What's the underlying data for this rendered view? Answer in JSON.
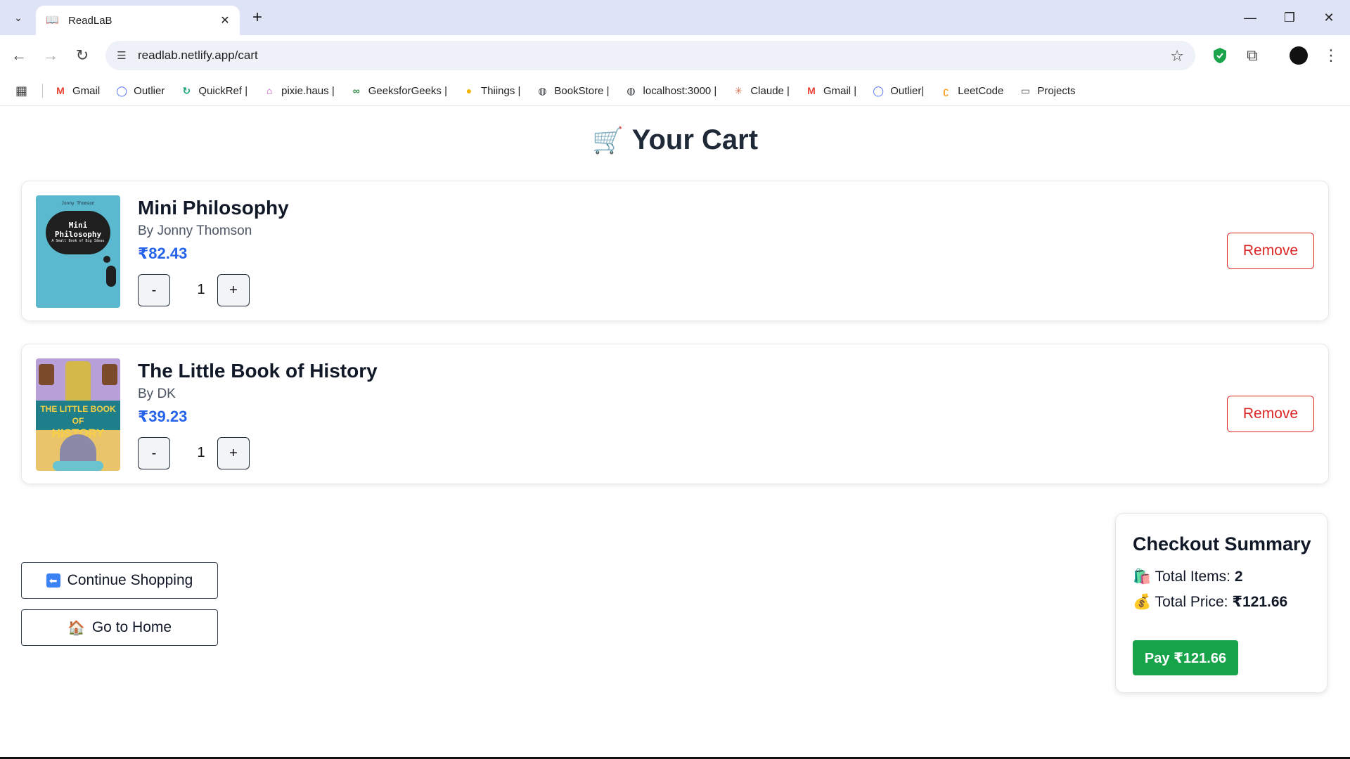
{
  "browser": {
    "tab_title": "ReadLaB",
    "url": "readlab.netlify.app/cart",
    "bookmarks": [
      {
        "label": "Gmail",
        "icon": "gmail-icon",
        "color": "#ea4335",
        "glyph": "M"
      },
      {
        "label": "Outlier",
        "icon": "outlier-icon",
        "color": "#4f6df5",
        "glyph": "◯"
      },
      {
        "label": "QuickRef |",
        "icon": "quickref-icon",
        "color": "#1aa37a",
        "glyph": "↻"
      },
      {
        "label": "pixie.haus |",
        "icon": "pixie-icon",
        "color": "#c040c0",
        "glyph": "⌂"
      },
      {
        "label": "GeeksforGeeks |",
        "icon": "gfg-icon",
        "color": "#2f8d46",
        "glyph": "∞"
      },
      {
        "label": "Thiings |",
        "icon": "thiings-icon",
        "color": "#f5b400",
        "glyph": "●"
      },
      {
        "label": "BookStore |",
        "icon": "globe-icon",
        "color": "#3c4043",
        "glyph": "◍"
      },
      {
        "label": "localhost:3000 |",
        "icon": "globe-icon",
        "color": "#3c4043",
        "glyph": "◍"
      },
      {
        "label": "Claude |",
        "icon": "claude-icon",
        "color": "#d97757",
        "glyph": "✳"
      },
      {
        "label": "Gmail |",
        "icon": "gmail-icon",
        "color": "#ea4335",
        "glyph": "M"
      },
      {
        "label": "Outlier|",
        "icon": "outlier-icon",
        "color": "#4f6df5",
        "glyph": "◯"
      },
      {
        "label": "LeetCode",
        "icon": "leetcode-icon",
        "color": "#f89f1b",
        "glyph": "ʗ"
      },
      {
        "label": "Projects",
        "icon": "folder-icon",
        "color": "#444444",
        "glyph": "▭"
      }
    ]
  },
  "page": {
    "title": "Your Cart",
    "items": [
      {
        "title": "Mini Philosophy",
        "author": "By Jonny Thomson",
        "price": "₹82.43",
        "quantity": "1",
        "minus": "-",
        "plus": "+",
        "remove": "Remove",
        "cover": {
          "line1": "Jonny Thomson",
          "line2": "Mini",
          "line3": "Philosophy",
          "line4": "A Small Book of Big Ideas"
        }
      },
      {
        "title": "The Little Book of History",
        "author": "By DK",
        "price": "₹39.23",
        "quantity": "1",
        "minus": "-",
        "plus": "+",
        "remove": "Remove",
        "cover": {
          "line1": "THE LITTLE BOOK OF",
          "line2": "HISTORY"
        }
      }
    ],
    "continue_shopping": "Continue Shopping",
    "go_home": "Go to Home",
    "summary": {
      "title": "Checkout Summary",
      "items_label": "Total Items:",
      "items_value": "2",
      "price_label": "Total Price:",
      "price_value": "₹121.66",
      "pay_label": "Pay ₹121.66"
    }
  },
  "colors": {
    "accent_price": "#2563eb",
    "remove": "#dc2626",
    "pay": "#16a34a"
  }
}
